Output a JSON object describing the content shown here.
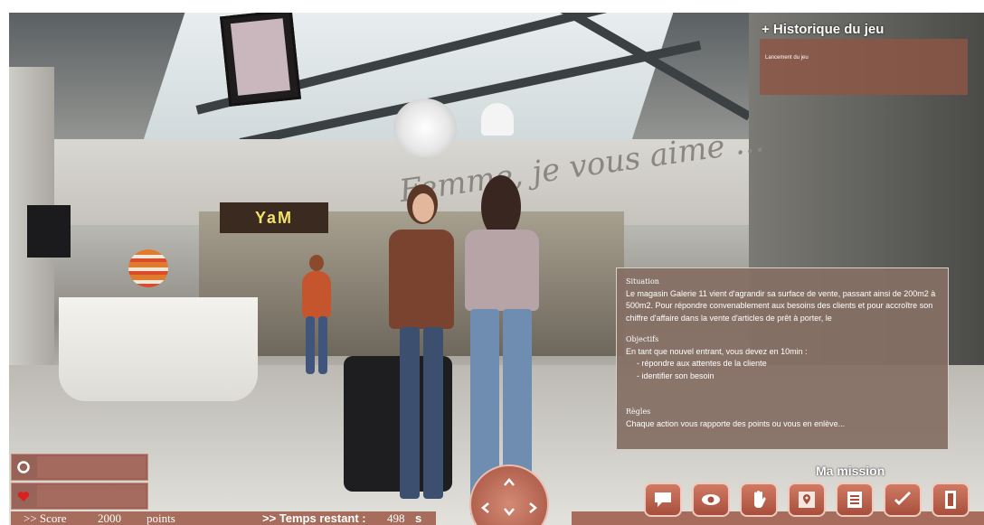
{
  "scene": {
    "wall_text": "Femme, je vous aime ...",
    "shop_sign": "YaM"
  },
  "history": {
    "title": "+ Historique du jeu",
    "entries": [
      "Lancement du jeu"
    ]
  },
  "mission_panel": {
    "situation_heading": "Situation",
    "situation_text": "Le magasin Galerie 11 vient d'agrandir sa surface de vente, passant ainsi de 200m2 à 500m2. Pour répondre convenablement aux besoins des clients et pour accroître son chiffre d'affaire dans la vente d'articles de prêt à porter, le",
    "objectives_heading": "Objectifs",
    "objectives_intro": "En tant que nouvel entrant, vous devez en 10min :",
    "objectives": [
      "- répondre aux attentes de la cliente",
      "- identifier son besoin"
    ],
    "rules_heading": "Règles",
    "rules_text": "Chaque action vous rapporte des points ou vous en enlève..."
  },
  "mission_label": "Ma mission",
  "actions": [
    {
      "name": "talk",
      "icon": "speech-bubble-icon"
    },
    {
      "name": "look",
      "icon": "eye-icon"
    },
    {
      "name": "hand",
      "icon": "hand-icon"
    },
    {
      "name": "map",
      "icon": "map-pin-icon"
    },
    {
      "name": "notes",
      "icon": "document-icon"
    },
    {
      "name": "validate",
      "icon": "checkmark-icon"
    },
    {
      "name": "exit",
      "icon": "door-icon"
    }
  ],
  "score": {
    "prefix": ">> Score",
    "value": "2000",
    "unit": "points"
  },
  "timer": {
    "label": ">> Temps restant :",
    "value": "498",
    "unit": "s"
  },
  "colors": {
    "hud_red": "#a05f4e",
    "panel_brown": "#856f64",
    "heart_red": "#d9211f"
  }
}
